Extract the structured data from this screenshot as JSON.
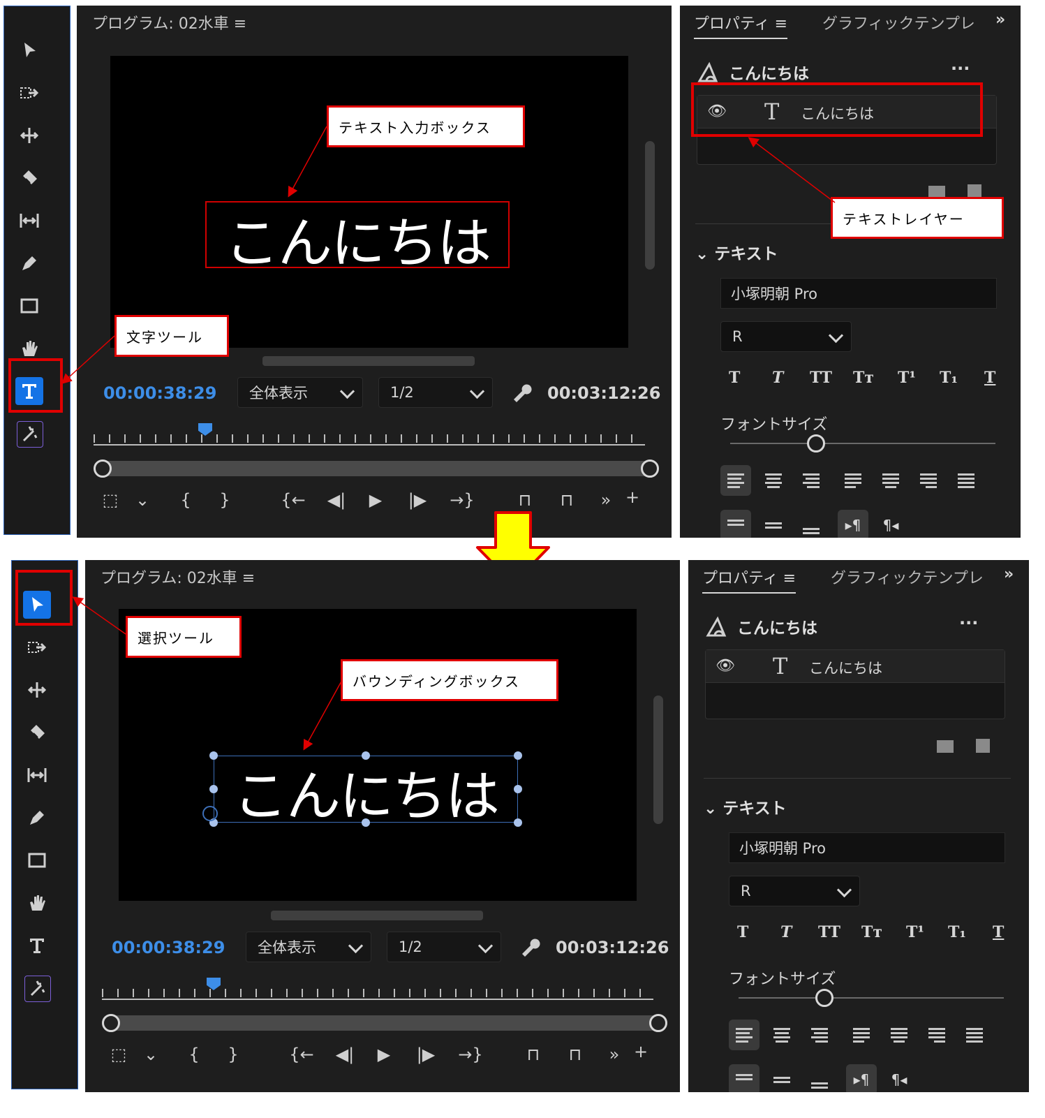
{
  "top": {
    "program_title": "プログラム: 02水車",
    "timecode_current": "00:00:38:29",
    "zoom_label": "全体表示",
    "resolution_label": "1/2",
    "timecode_duration": "00:03:12:26",
    "monitor_text": "こんにちは",
    "props_tab": "プロパティ",
    "graphics_tab": "グラフィックテンプレ",
    "clip_name": "こんにちは",
    "layer_name": "こんにちは",
    "section_text": "テキスト",
    "font_family": "小塚明朝 Pro",
    "font_style": "R",
    "font_size_label": "フォントサイズ",
    "callout_textbox": "テキスト入力ボックス",
    "callout_textlayer": "テキストレイヤー",
    "callout_texttool": "文字ツール"
  },
  "bottom": {
    "program_title": "プログラム: 02水車",
    "timecode_current": "00:00:38:29",
    "zoom_label": "全体表示",
    "resolution_label": "1/2",
    "timecode_duration": "00:03:12:26",
    "monitor_text": "こんにちは",
    "props_tab": "プロパティ",
    "graphics_tab": "グラフィックテンプレ",
    "clip_name": "こんにちは",
    "layer_name": "こんにちは",
    "section_text": "テキスト",
    "font_family": "小塚明朝 Pro",
    "font_style": "R",
    "font_size_label": "フォントサイズ",
    "callout_boundingbox": "バウンディングボックス",
    "callout_selecttool": "選択ツール"
  },
  "text_style_buttons": [
    "T",
    "T",
    "TT",
    "Tт",
    "T¹",
    "T₁",
    "T"
  ],
  "playback_controls": [
    "{",
    "}",
    "{←",
    "◀|",
    "▶",
    "|▶",
    "→}",
    "»",
    "+"
  ],
  "colors": {
    "accent_blue": "#1473e6",
    "timecode_blue": "#3d8ee8",
    "annotation_red": "#e00000",
    "arrow_yellow": "#ffff00"
  }
}
